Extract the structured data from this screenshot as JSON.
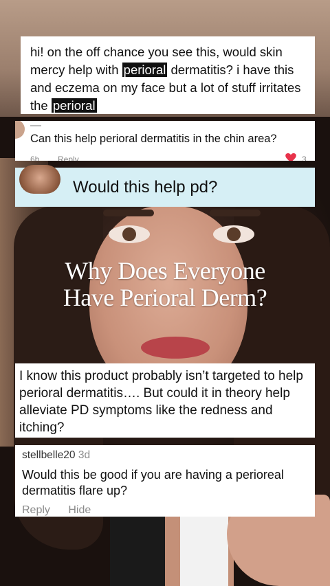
{
  "comment_one": {
    "part1": "hi! on the off chance you see this, would skin mercy help with ",
    "highlight1": "perioral",
    "part2": " dermatitis? i have this and eczema on my face but a lot of stuff irritates the ",
    "highlight2": "perioral",
    "part3": ""
  },
  "comment_two": {
    "text": "Can this help perioral dermatitis in the chin area?",
    "time": "6h",
    "reply": "Reply",
    "likes": "3",
    "heart_color": "#e8334b"
  },
  "comment_three": {
    "text": "Would this help pd?",
    "background": "#d6eff5"
  },
  "video_title": {
    "line1": "Why Does Everyone",
    "line2": "Have Perioral Derm?"
  },
  "comment_four": {
    "text": "I know this product probably isn’t targeted to help perioral dermatitis…. But could it in theory help alleviate PD symptoms like the redness and itching?"
  },
  "comment_five": {
    "username": "stellbelle20",
    "timestamp": "3d",
    "text": "Would this be good if you are having a perioreal dermatitis flare up?",
    "reply": "Reply",
    "hide": "Hide"
  }
}
